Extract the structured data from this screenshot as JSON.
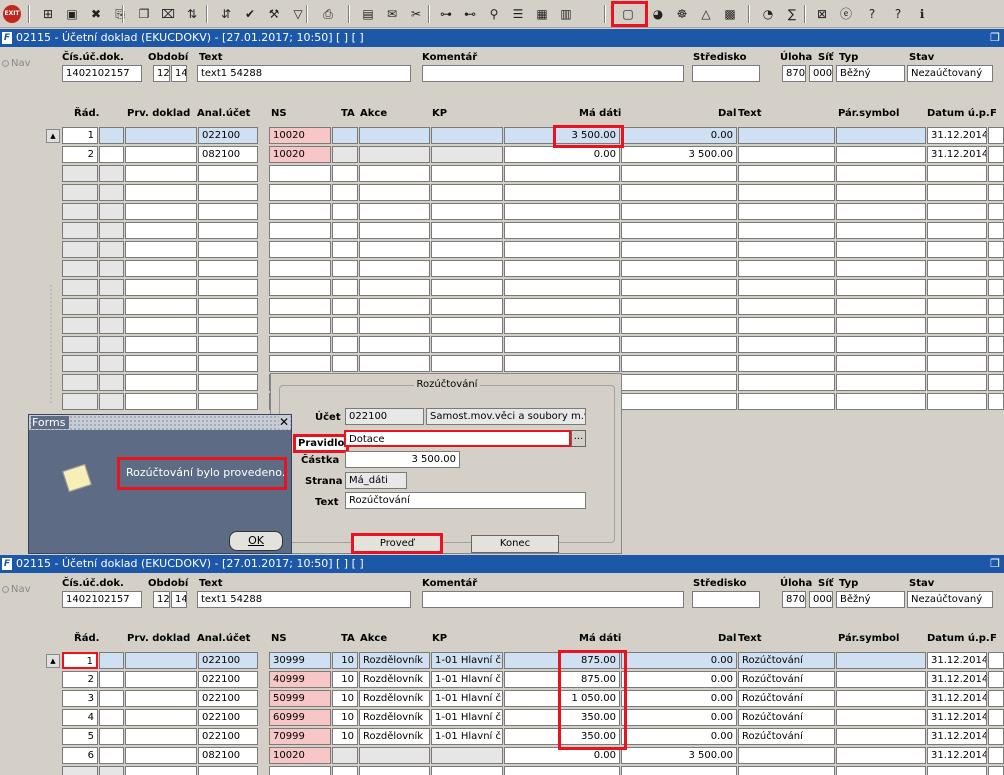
{
  "toolbar": {
    "exit_label": "EXIT",
    "icons": [
      "exit-icon",
      "insert-record-icon",
      "save-icon",
      "delete-record-icon",
      "copy-record-icon",
      "duplicate-icon",
      "clear-icon",
      "sort-asc-icon",
      "sort-desc-icon",
      "accept-icon",
      "wrench-icon",
      "filter-icon",
      "print-icon",
      "print-preview-icon",
      "mail-icon",
      "cut-icon",
      "tree-icon",
      "tree2-icon",
      "query-icon",
      "list-icon",
      "grid-icon",
      "document-export-icon",
      "form-icon",
      "globe-icon",
      "wheel-icon",
      "triangle-icon",
      "calc-icon",
      "clock-icon",
      "sum-icon",
      "window-icon",
      "ie-icon",
      "help-icon",
      "context-help-icon",
      "info-icon"
    ]
  },
  "window_top": {
    "title": "02115 - Účetní doklad (EKUCDOKV) - [27.01.2017; 10:50] [ ] [ ]",
    "nav_label": "Nav"
  },
  "window_bottom": {
    "title": "02115 - Účetní doklad (EKUCDOKV) - [27.01.2017; 10:50] [ ] [ ]",
    "nav_label": "Nav"
  },
  "header": {
    "labels": {
      "cis_uc_dok": "Čís.úč.dok.",
      "obdobi": "Období",
      "text": "Text",
      "komentar": "Komentář",
      "stredisko": "Středisko",
      "uloha": "Úloha",
      "sit": "Síť",
      "typ": "Typ",
      "stav": "Stav"
    },
    "values": {
      "cis_uc_dok": "1402102157",
      "obdobi_m": "12",
      "obdobi_y": "14",
      "text": "text1 54288",
      "komentar": "",
      "stredisko": "",
      "uloha": "870",
      "sit": "000",
      "typ": "Běžný",
      "stav": "Nezaúčtovaný"
    }
  },
  "columns": {
    "rad": "Řád.",
    "prv_doklad": "Prv. doklad",
    "anal_ucet": "Anal.účet",
    "ns": "NS",
    "ta": "TA",
    "akce": "Akce",
    "kp": "KP",
    "ma_dati": "Má dáti",
    "dal": "Dal",
    "text": "Text",
    "par_symbol": "Pár.symbol",
    "datum_up": "Datum ú.p.",
    "extra": "F"
  },
  "rows_top": [
    {
      "rad": "1",
      "prv": "",
      "anal": "022100",
      "ns": "10020",
      "ta": "",
      "akce": "",
      "kp": "",
      "ma": "3 500.00",
      "dal": "0.00",
      "text": "",
      "par": "",
      "datum": "31.12.2014"
    },
    {
      "rad": "2",
      "prv": "",
      "anal": "082100",
      "ns": "10020",
      "ta": "",
      "akce": "",
      "kp": "",
      "ma": "0.00",
      "dal": "3 500.00",
      "text": "",
      "par": "",
      "datum": "31.12.2014"
    }
  ],
  "rows_bottom": [
    {
      "rad": "1",
      "prv": "",
      "anal": "022100",
      "ns": "30999",
      "ta": "10",
      "akce": "Rozdělovník",
      "kp": "1-01 Hlavní či",
      "ma": "875.00",
      "dal": "0.00",
      "text": "Rozúčtování",
      "par": "",
      "datum": "31.12.2014"
    },
    {
      "rad": "2",
      "prv": "",
      "anal": "022100",
      "ns": "40999",
      "ta": "10",
      "akce": "Rozdělovník",
      "kp": "1-01 Hlavní či",
      "ma": "875.00",
      "dal": "0.00",
      "text": "Rozúčtování",
      "par": "",
      "datum": "31.12.2014"
    },
    {
      "rad": "3",
      "prv": "",
      "anal": "022100",
      "ns": "50999",
      "ta": "10",
      "akce": "Rozdělovník",
      "kp": "1-01 Hlavní či",
      "ma": "1 050.00",
      "dal": "0.00",
      "text": "Rozúčtování",
      "par": "",
      "datum": "31.12.2014"
    },
    {
      "rad": "4",
      "prv": "",
      "anal": "022100",
      "ns": "60999",
      "ta": "10",
      "akce": "Rozdělovník",
      "kp": "1-01 Hlavní či",
      "ma": "350.00",
      "dal": "0.00",
      "text": "Rozúčtování",
      "par": "",
      "datum": "31.12.2014"
    },
    {
      "rad": "5",
      "prv": "",
      "anal": "022100",
      "ns": "70999",
      "ta": "10",
      "akce": "Rozdělovník",
      "kp": "1-01 Hlavní či",
      "ma": "350.00",
      "dal": "0.00",
      "text": "Rozúčtování",
      "par": "",
      "datum": "31.12.2014"
    },
    {
      "rad": "6",
      "prv": "",
      "anal": "082100",
      "ns": "10020",
      "ta": "",
      "akce": "",
      "kp": "",
      "ma": "0.00",
      "dal": "3 500.00",
      "text": "",
      "par": "",
      "datum": "31.12.2014"
    }
  ],
  "rozuctovani": {
    "title": "Rozúčtování",
    "ucet_label": "Účet",
    "ucet_value": "022100",
    "ucet_desc": "Samost.mov.věci a soubory m.v.",
    "pravidlo_label": "Pravidlo",
    "pravidlo_value": "Dotace",
    "lov_label": "...",
    "castka_label": "Částka",
    "castka_value": "3 500.00",
    "strana_label": "Strana",
    "strana_value": "Má_dáti",
    "text_label": "Text",
    "text_value": "Rozúčtování",
    "provest_label": "Proveď",
    "konec_label": "Konec"
  },
  "forms_dialog": {
    "title": "Forms",
    "close_label": "✕",
    "message": "Rozúčtování bylo provedeno.",
    "ok_label": "OK"
  },
  "colors": {
    "titlebar": "#1c57a8",
    "highlight": "#e8131e",
    "row_selected": "#cfe0f2",
    "ns_pink": "#f7c6c6",
    "dialog_bg": "#5d6b84"
  }
}
